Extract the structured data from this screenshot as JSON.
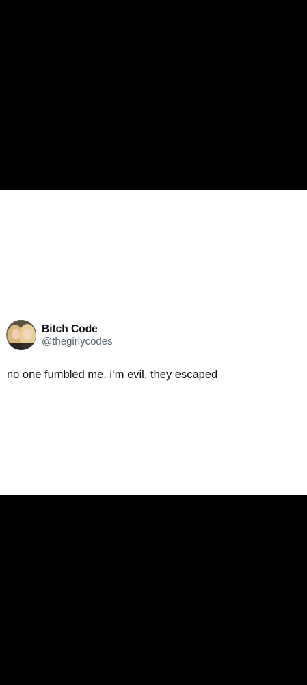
{
  "colors": {
    "background": "#000000",
    "card": "#ffffff",
    "name_text": "#0f1419",
    "handle_text": "#536471"
  },
  "tweet": {
    "author": {
      "display_name": "Bitch Code",
      "handle": "@thegirlycodes",
      "avatar_icon": "profile-photo-avatar"
    },
    "text": "no one fumbled me. i’m evil, they escaped"
  }
}
